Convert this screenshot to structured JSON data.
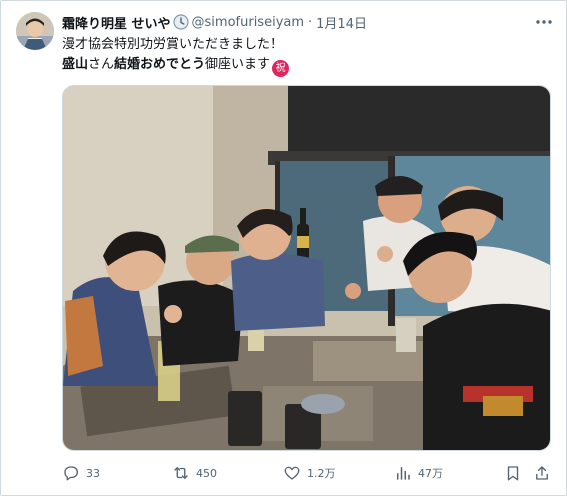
{
  "user": {
    "display_name": "霜降り明星 せいや",
    "badge_icon": "clock-icon",
    "handle": "@simofuriseiyam",
    "separator": "·",
    "date": "1月14日"
  },
  "tweet": {
    "line1": "漫才協会特別功労賞いただきました！",
    "line2_bold1": "盛山",
    "line2_text1": "さん",
    "line2_bold2": "結婚おめでとう",
    "line2_text2": "御座います",
    "emoji_label": "祝"
  },
  "photo": {
    "description_icon": "group-photo"
  },
  "actions": {
    "replies": "33",
    "reposts": "450",
    "likes": "1.2万",
    "views": "47万"
  },
  "colors": {
    "text_primary": "#0f1419",
    "text_secondary": "#536471",
    "border": "#cfd9de",
    "iwai_emoji": "#e0245e"
  }
}
